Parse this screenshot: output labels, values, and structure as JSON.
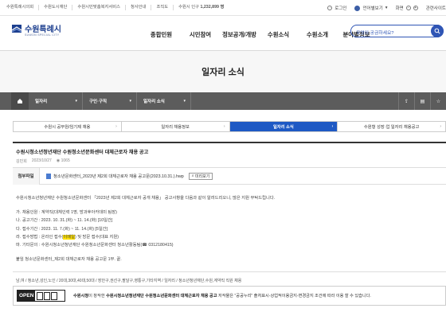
{
  "topbar": {
    "links": [
      "수원특례시의회",
      "수원도시재단",
      "수원시민맞춤복지서비스",
      "청사안내",
      "조직도"
    ],
    "population_label": "수원시 인구",
    "population_value": "1,232,899 명",
    "login": "로그인",
    "language": "언어별보기",
    "zoom_label": "화면",
    "related": "관련사이트"
  },
  "header": {
    "logo_text": "수원특례시",
    "logo_sub": "SUWON SPECIAL CITY",
    "gnb": [
      "종합민원",
      "시민참여",
      "정보공개/개방",
      "수원소식",
      "수원소개",
      "분야별정보"
    ],
    "search_placeholder": "무엇이 궁금하세요?"
  },
  "banner": {
    "title": "일자리 소식"
  },
  "breadcrumb": {
    "home_label": "홈",
    "segments": [
      "일자리",
      "구인·구직",
      "일자리 소식"
    ]
  },
  "tabs": [
    {
      "label": "수원시 공무원/임기제 채용",
      "active": false
    },
    {
      "label": "일자리 채용정보",
      "active": false
    },
    {
      "label": "일자리 소식",
      "active": true
    },
    {
      "label": "수원형 성장·업 일자리 채용공고",
      "active": false
    }
  ],
  "article": {
    "title": "수원시청소년청년재단 수원청소년문화센터 대체근로자 채용 공고",
    "author": "김민희",
    "date": "2023/10/27",
    "views": "1065",
    "attach_label": "첨부파일",
    "file_name": "청소년문화센터_2023년 제2회 대체근로자 채용 공고문(2023.10.31.).hwp",
    "preview_label": "미리보기",
    "intro": "수원시청소년청년재단 수원청소년문화센터 「2023년 제2회 대체근로자 공개 채용」 공고사항을 다음과 같이 알려드리오니, 많은 지원 부탁드립니다.",
    "items": [
      "가. 채용인원 : 계약직(대체인력 1명, 방과후아카데미 팀장)",
      "나. 공고기간 : 2023. 10. 31.(화) ~ 11. 14.(화) [10일간]",
      "다. 접수기간 : 2023. 11. 7.(화) ~ 11. 14.(화) [5일간]"
    ],
    "item4_prefix": "라. 접수방법 : 온라인 접수(",
    "item4_highlight": "이메일",
    "item4_suffix": ") 및 방문 접수(대표 지원)",
    "item5": "마. 기타문의 : 수원시청소년청년재단 수원청소년문화센터 청소년활동팀(☎ 0312180415)",
    "attachment_note": "붙임  청소년문화센터_제2회 대체근로자 채용 공고문 1부.  끝.",
    "footer_tags": "남,여 / 청소년,성인,노인 / 20대,30대,40대,50대 / 장안구,권선구,팔달구,영통구,기타지역 / 일자리 / 청소년청년재단,수원,계약직 직원 채용"
  },
  "license": {
    "badge": "OPEN",
    "text_prefix": "수원시청",
    "text_mid": "이 창작한 ",
    "text_bold": "수원시청소년청년재단 수원청소년문화센터 대체근로자 채용 공고",
    "text_rest": " 저작물은 \"공공누리\" 출처표시-상업적이용금지-변경금지 조건에 따라 이용 할 수 있습니다."
  }
}
